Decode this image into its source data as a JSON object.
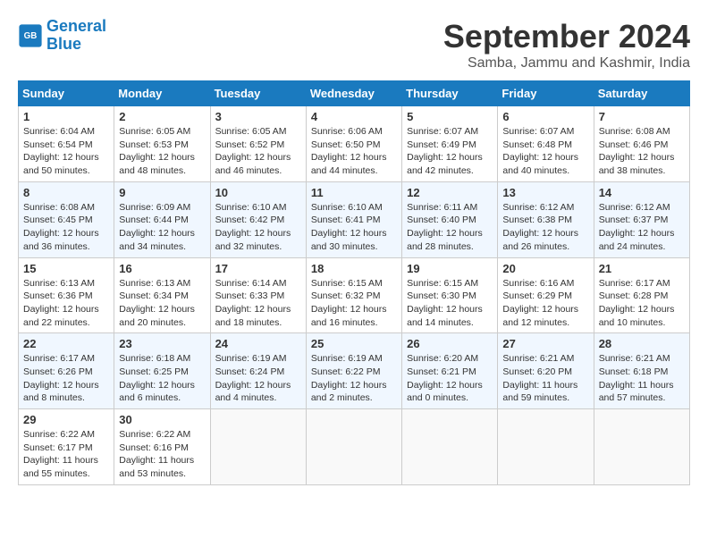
{
  "header": {
    "logo_line1": "General",
    "logo_line2": "Blue",
    "title": "September 2024",
    "location": "Samba, Jammu and Kashmir, India"
  },
  "calendar": {
    "days_of_week": [
      "Sunday",
      "Monday",
      "Tuesday",
      "Wednesday",
      "Thursday",
      "Friday",
      "Saturday"
    ],
    "weeks": [
      [
        {
          "day": "1",
          "sunrise": "6:04 AM",
          "sunset": "6:54 PM",
          "daylight": "12 hours and 50 minutes."
        },
        {
          "day": "2",
          "sunrise": "6:05 AM",
          "sunset": "6:53 PM",
          "daylight": "12 hours and 48 minutes."
        },
        {
          "day": "3",
          "sunrise": "6:05 AM",
          "sunset": "6:52 PM",
          "daylight": "12 hours and 46 minutes."
        },
        {
          "day": "4",
          "sunrise": "6:06 AM",
          "sunset": "6:50 PM",
          "daylight": "12 hours and 44 minutes."
        },
        {
          "day": "5",
          "sunrise": "6:07 AM",
          "sunset": "6:49 PM",
          "daylight": "12 hours and 42 minutes."
        },
        {
          "day": "6",
          "sunrise": "6:07 AM",
          "sunset": "6:48 PM",
          "daylight": "12 hours and 40 minutes."
        },
        {
          "day": "7",
          "sunrise": "6:08 AM",
          "sunset": "6:46 PM",
          "daylight": "12 hours and 38 minutes."
        }
      ],
      [
        {
          "day": "8",
          "sunrise": "6:08 AM",
          "sunset": "6:45 PM",
          "daylight": "12 hours and 36 minutes."
        },
        {
          "day": "9",
          "sunrise": "6:09 AM",
          "sunset": "6:44 PM",
          "daylight": "12 hours and 34 minutes."
        },
        {
          "day": "10",
          "sunrise": "6:10 AM",
          "sunset": "6:42 PM",
          "daylight": "12 hours and 32 minutes."
        },
        {
          "day": "11",
          "sunrise": "6:10 AM",
          "sunset": "6:41 PM",
          "daylight": "12 hours and 30 minutes."
        },
        {
          "day": "12",
          "sunrise": "6:11 AM",
          "sunset": "6:40 PM",
          "daylight": "12 hours and 28 minutes."
        },
        {
          "day": "13",
          "sunrise": "6:12 AM",
          "sunset": "6:38 PM",
          "daylight": "12 hours and 26 minutes."
        },
        {
          "day": "14",
          "sunrise": "6:12 AM",
          "sunset": "6:37 PM",
          "daylight": "12 hours and 24 minutes."
        }
      ],
      [
        {
          "day": "15",
          "sunrise": "6:13 AM",
          "sunset": "6:36 PM",
          "daylight": "12 hours and 22 minutes."
        },
        {
          "day": "16",
          "sunrise": "6:13 AM",
          "sunset": "6:34 PM",
          "daylight": "12 hours and 20 minutes."
        },
        {
          "day": "17",
          "sunrise": "6:14 AM",
          "sunset": "6:33 PM",
          "daylight": "12 hours and 18 minutes."
        },
        {
          "day": "18",
          "sunrise": "6:15 AM",
          "sunset": "6:32 PM",
          "daylight": "12 hours and 16 minutes."
        },
        {
          "day": "19",
          "sunrise": "6:15 AM",
          "sunset": "6:30 PM",
          "daylight": "12 hours and 14 minutes."
        },
        {
          "day": "20",
          "sunrise": "6:16 AM",
          "sunset": "6:29 PM",
          "daylight": "12 hours and 12 minutes."
        },
        {
          "day": "21",
          "sunrise": "6:17 AM",
          "sunset": "6:28 PM",
          "daylight": "12 hours and 10 minutes."
        }
      ],
      [
        {
          "day": "22",
          "sunrise": "6:17 AM",
          "sunset": "6:26 PM",
          "daylight": "12 hours and 8 minutes."
        },
        {
          "day": "23",
          "sunrise": "6:18 AM",
          "sunset": "6:25 PM",
          "daylight": "12 hours and 6 minutes."
        },
        {
          "day": "24",
          "sunrise": "6:19 AM",
          "sunset": "6:24 PM",
          "daylight": "12 hours and 4 minutes."
        },
        {
          "day": "25",
          "sunrise": "6:19 AM",
          "sunset": "6:22 PM",
          "daylight": "12 hours and 2 minutes."
        },
        {
          "day": "26",
          "sunrise": "6:20 AM",
          "sunset": "6:21 PM",
          "daylight": "12 hours and 0 minutes."
        },
        {
          "day": "27",
          "sunrise": "6:21 AM",
          "sunset": "6:20 PM",
          "daylight": "11 hours and 59 minutes."
        },
        {
          "day": "28",
          "sunrise": "6:21 AM",
          "sunset": "6:18 PM",
          "daylight": "11 hours and 57 minutes."
        }
      ],
      [
        {
          "day": "29",
          "sunrise": "6:22 AM",
          "sunset": "6:17 PM",
          "daylight": "11 hours and 55 minutes."
        },
        {
          "day": "30",
          "sunrise": "6:22 AM",
          "sunset": "6:16 PM",
          "daylight": "11 hours and 53 minutes."
        },
        {
          "day": "",
          "sunrise": "",
          "sunset": "",
          "daylight": ""
        },
        {
          "day": "",
          "sunrise": "",
          "sunset": "",
          "daylight": ""
        },
        {
          "day": "",
          "sunrise": "",
          "sunset": "",
          "daylight": ""
        },
        {
          "day": "",
          "sunrise": "",
          "sunset": "",
          "daylight": ""
        },
        {
          "day": "",
          "sunrise": "",
          "sunset": "",
          "daylight": ""
        }
      ]
    ]
  }
}
